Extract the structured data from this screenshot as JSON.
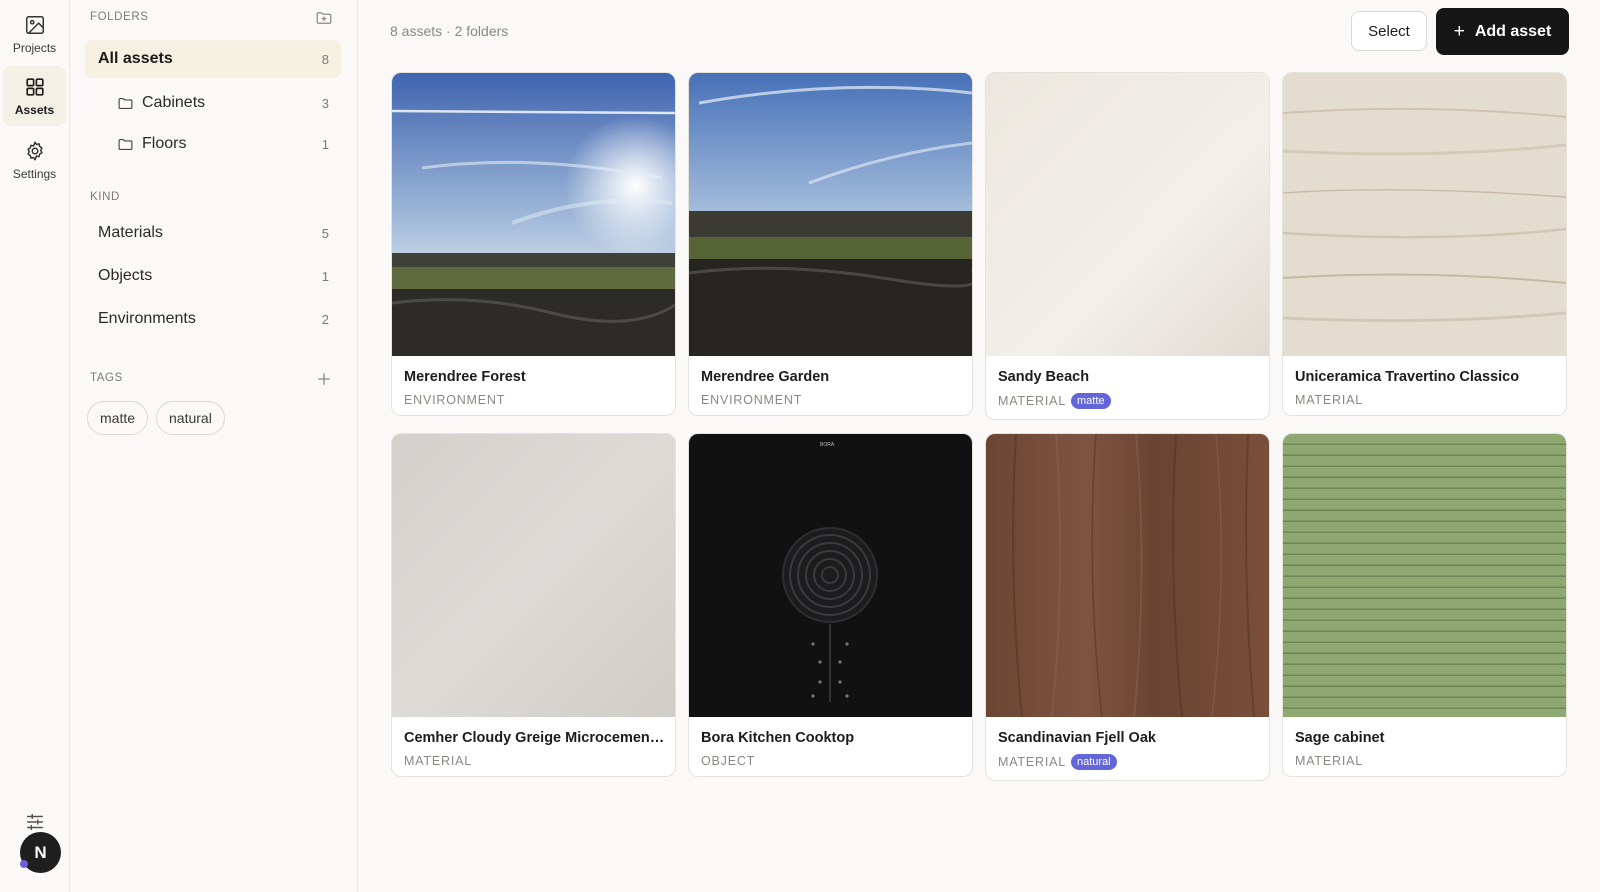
{
  "rail": {
    "items": [
      {
        "label": "Projects",
        "icon": "image-icon"
      },
      {
        "label": "Assets",
        "icon": "grid-icon"
      },
      {
        "label": "Settings",
        "icon": "gear-icon"
      }
    ],
    "avatar": "N"
  },
  "sidebar": {
    "folders_heading": "FOLDERS",
    "all_assets": {
      "label": "All assets",
      "count": "8"
    },
    "folders": [
      {
        "label": "Cabinets",
        "count": "3"
      },
      {
        "label": "Floors",
        "count": "1"
      }
    ],
    "kind_heading": "KIND",
    "kinds": [
      {
        "label": "Materials",
        "count": "5"
      },
      {
        "label": "Objects",
        "count": "1"
      },
      {
        "label": "Environments",
        "count": "2"
      }
    ],
    "tags_heading": "TAGS",
    "tags": [
      "matte",
      "natural"
    ]
  },
  "toolbar": {
    "summary": "8 assets · 2 folders",
    "select_label": "Select",
    "add_label": "Add asset"
  },
  "assets": [
    {
      "title": "Merendree Forest",
      "kind": "ENVIRONMENT",
      "tag": null
    },
    {
      "title": "Merendree Garden",
      "kind": "ENVIRONMENT",
      "tag": null
    },
    {
      "title": "Sandy Beach",
      "kind": "MATERIAL",
      "tag": "matte"
    },
    {
      "title": "Uniceramica Travertino Classico",
      "kind": "MATERIAL",
      "tag": null
    },
    {
      "title": "Cemher Cloudy Greige Microcement Plaster",
      "kind": "MATERIAL",
      "tag": null
    },
    {
      "title": "Bora Kitchen Cooktop",
      "kind": "OBJECT",
      "tag": null,
      "brand": "BORA"
    },
    {
      "title": "Scandinavian Fjell Oak",
      "kind": "MATERIAL",
      "tag": "natural"
    },
    {
      "title": "Sage cabinet",
      "kind": "MATERIAL",
      "tag": null
    }
  ],
  "colors": {
    "accent": "#6266d9",
    "primary_button": "#161616",
    "active_bg": "#f6f0e0"
  }
}
